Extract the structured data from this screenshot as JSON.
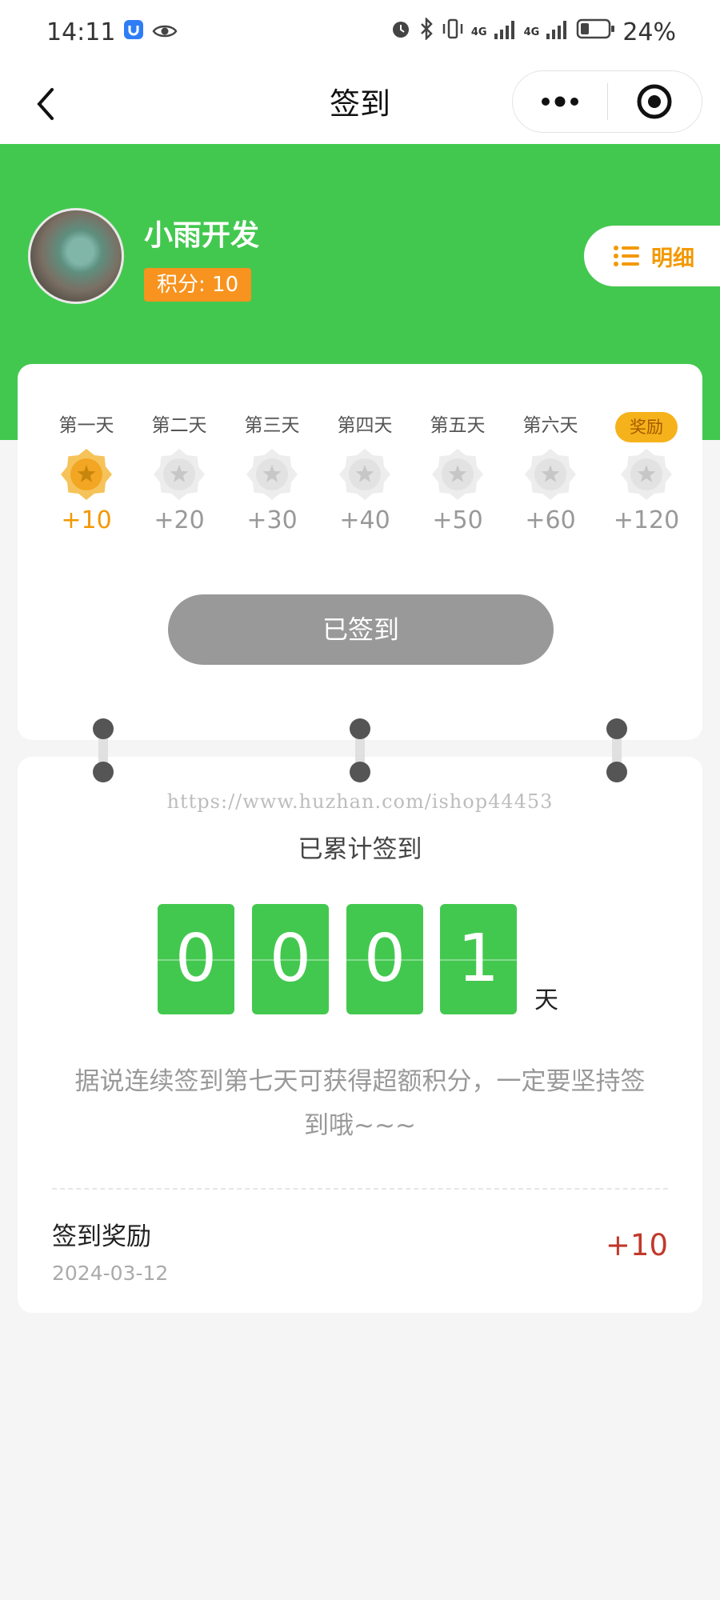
{
  "status_bar": {
    "time": "14:11",
    "battery": "24%",
    "network_1": "4G",
    "network_2": "4G",
    "icons": [
      "app-shield-icon",
      "eye-icon",
      "alarm-icon",
      "bluetooth-icon",
      "vibrate-icon",
      "signal-icon",
      "battery-icon"
    ]
  },
  "nav": {
    "title": "签到",
    "back_icon": "chevron-left-icon",
    "more_icon": "more-dots-icon",
    "close_icon": "target-icon"
  },
  "profile": {
    "name": "小雨开发",
    "points_label": "积分: 10",
    "detail_label": "明细",
    "detail_icon": "list-icon"
  },
  "checkin_days": [
    {
      "label": "第一天",
      "points": "+10",
      "checked": true
    },
    {
      "label": "第二天",
      "points": "+20",
      "checked": false
    },
    {
      "label": "第三天",
      "points": "+30",
      "checked": false
    },
    {
      "label": "第四天",
      "points": "+40",
      "checked": false
    },
    {
      "label": "第五天",
      "points": "+50",
      "checked": false
    },
    {
      "label": "第六天",
      "points": "+60",
      "checked": false
    },
    {
      "label": "奖励",
      "points": "+120",
      "checked": false,
      "is_reward": true
    }
  ],
  "signed_button": "已签到",
  "watermark": "https://www.huzhan.com/ishop44453",
  "total": {
    "label": "已累计签到",
    "digits": [
      "0",
      "0",
      "0",
      "1"
    ],
    "unit": "天"
  },
  "tip": "据说连续签到第七天可获得超额积分，一定要坚持签到哦~~~",
  "records": [
    {
      "title": "签到奖励",
      "date": "2024-03-12",
      "points": "+10"
    }
  ],
  "colors": {
    "brand_green": "#43c84f",
    "orange": "#f7931e",
    "gold": "#f39800",
    "reward_red": "#c0392b",
    "disabled_gray": "#999999"
  }
}
